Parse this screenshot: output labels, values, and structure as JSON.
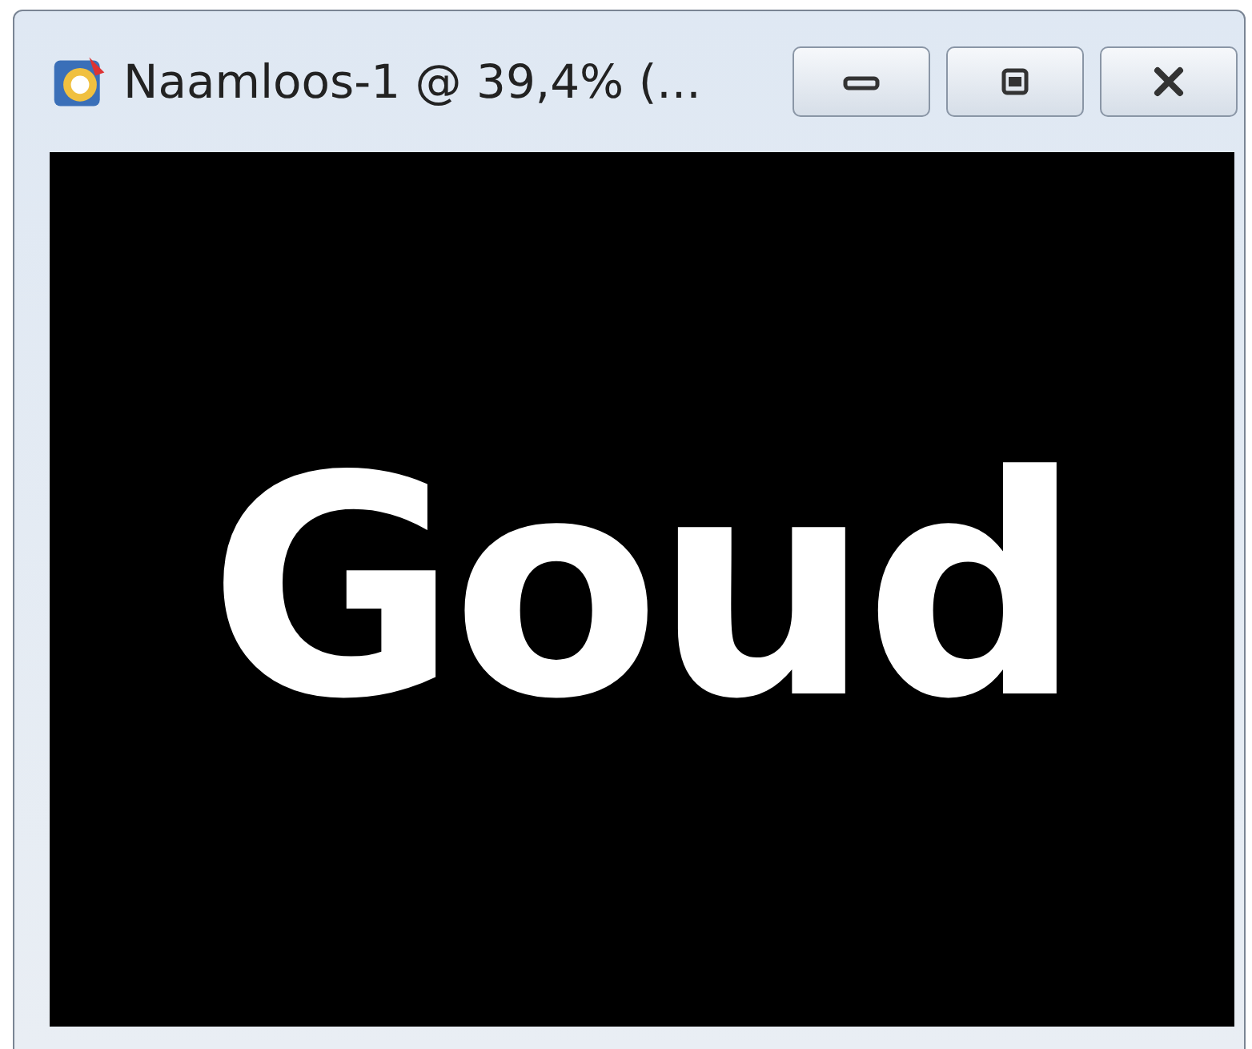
{
  "window": {
    "title": "Naamloos-1 @ 39,4% (..."
  },
  "canvas": {
    "text": "Goud"
  }
}
